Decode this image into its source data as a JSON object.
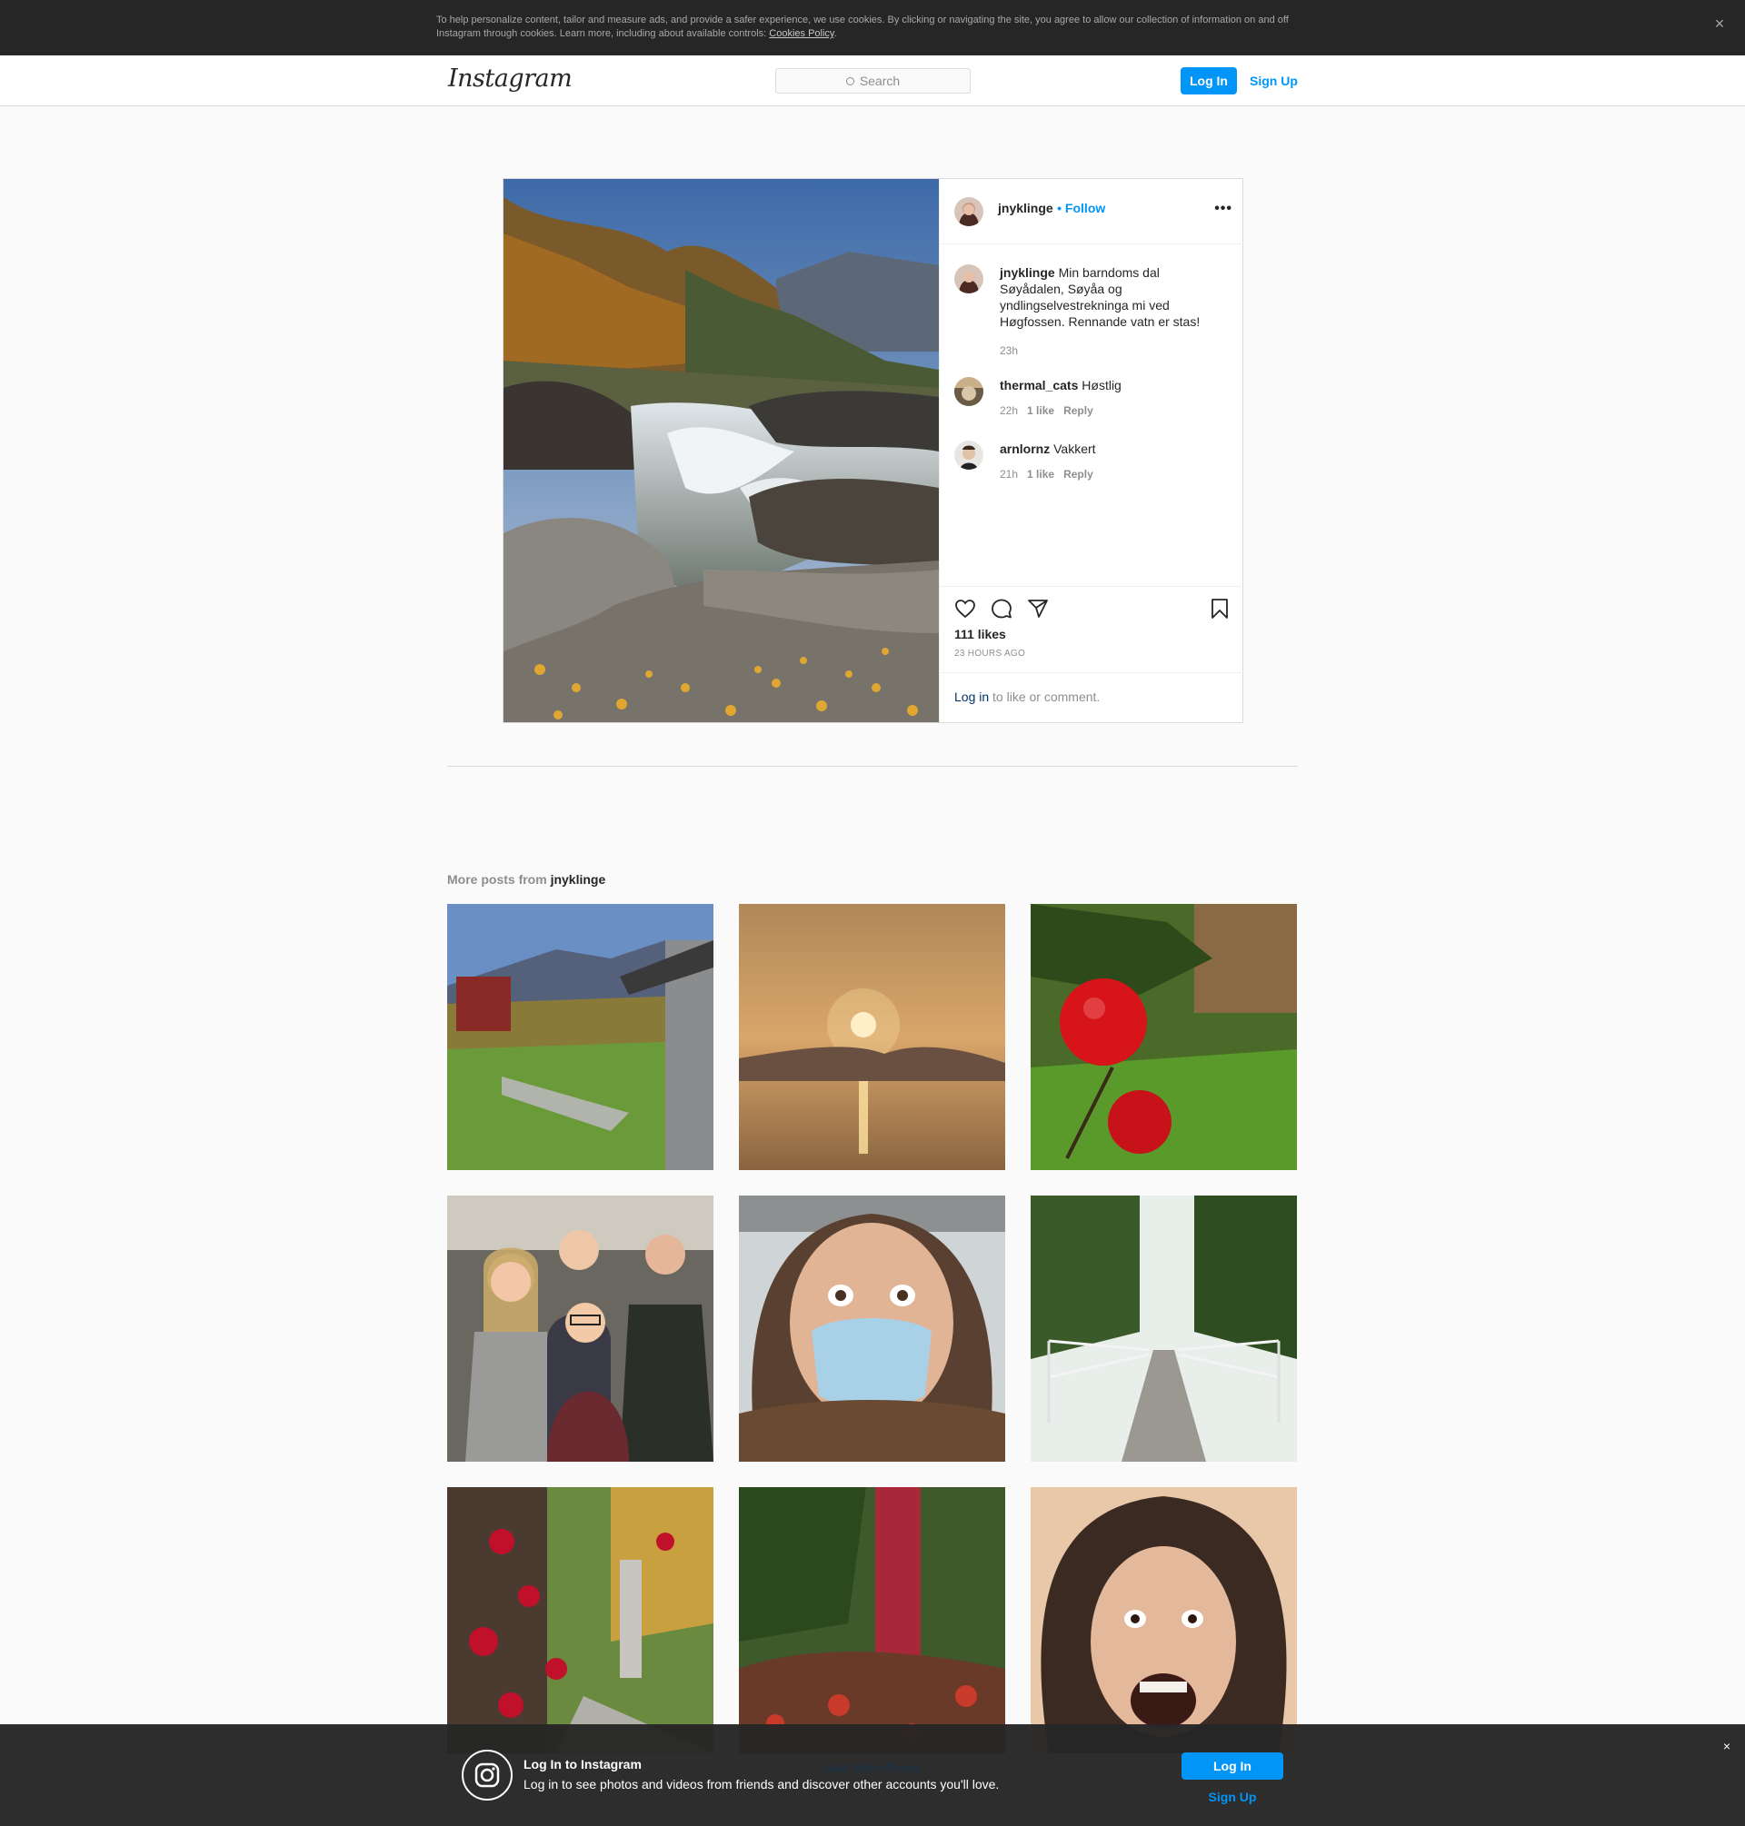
{
  "cookie": {
    "text": "To help personalize content, tailor and measure ads, and provide a safer experience, we use cookies. By clicking or navigating the site, you agree to allow our collection of information on and off Instagram through cookies. Learn more, including about available controls: ",
    "link": "Cookies Policy",
    "end": ".",
    "close": "×"
  },
  "header": {
    "logo": "Instagram",
    "search_placeholder": "Search",
    "login": "Log In",
    "signup": "Sign Up"
  },
  "post": {
    "username": "jnyklinge",
    "follow": "• Follow",
    "more": "•••",
    "caption": {
      "username": "jnyklinge",
      "text": "Min barndoms dal⁣ Søyådalen, Søyåa og yndlingselvestrekninga mi ved Høgfossen. Rennande vatn er stas!",
      "time": "23h"
    },
    "comments": [
      {
        "username": "thermal_cats",
        "text": "Høstlig⁣",
        "time": "22h",
        "likes": "1 like",
        "reply": "Reply"
      },
      {
        "username": "arnlornz",
        "text": "Vakkert⁣",
        "time": "21h",
        "likes": "1 like",
        "reply": "Reply"
      }
    ],
    "likes": "111 likes",
    "date": "23 HOURS AGO",
    "login_link": "Log in",
    "login_rest": " to like or comment."
  },
  "more_posts": {
    "prefix": "More posts from ",
    "username": "jnyklinge"
  },
  "bottom": {
    "title": "Log In to Instagram",
    "text": "Log in to see photos and videos from friends and discover other accounts you'll love.",
    "login": "Log In",
    "signup": "Sign Up",
    "close": "×",
    "see_more": "See More Posts"
  },
  "colors": {
    "accent": "#0095f6",
    "link_dark": "#00376b"
  }
}
